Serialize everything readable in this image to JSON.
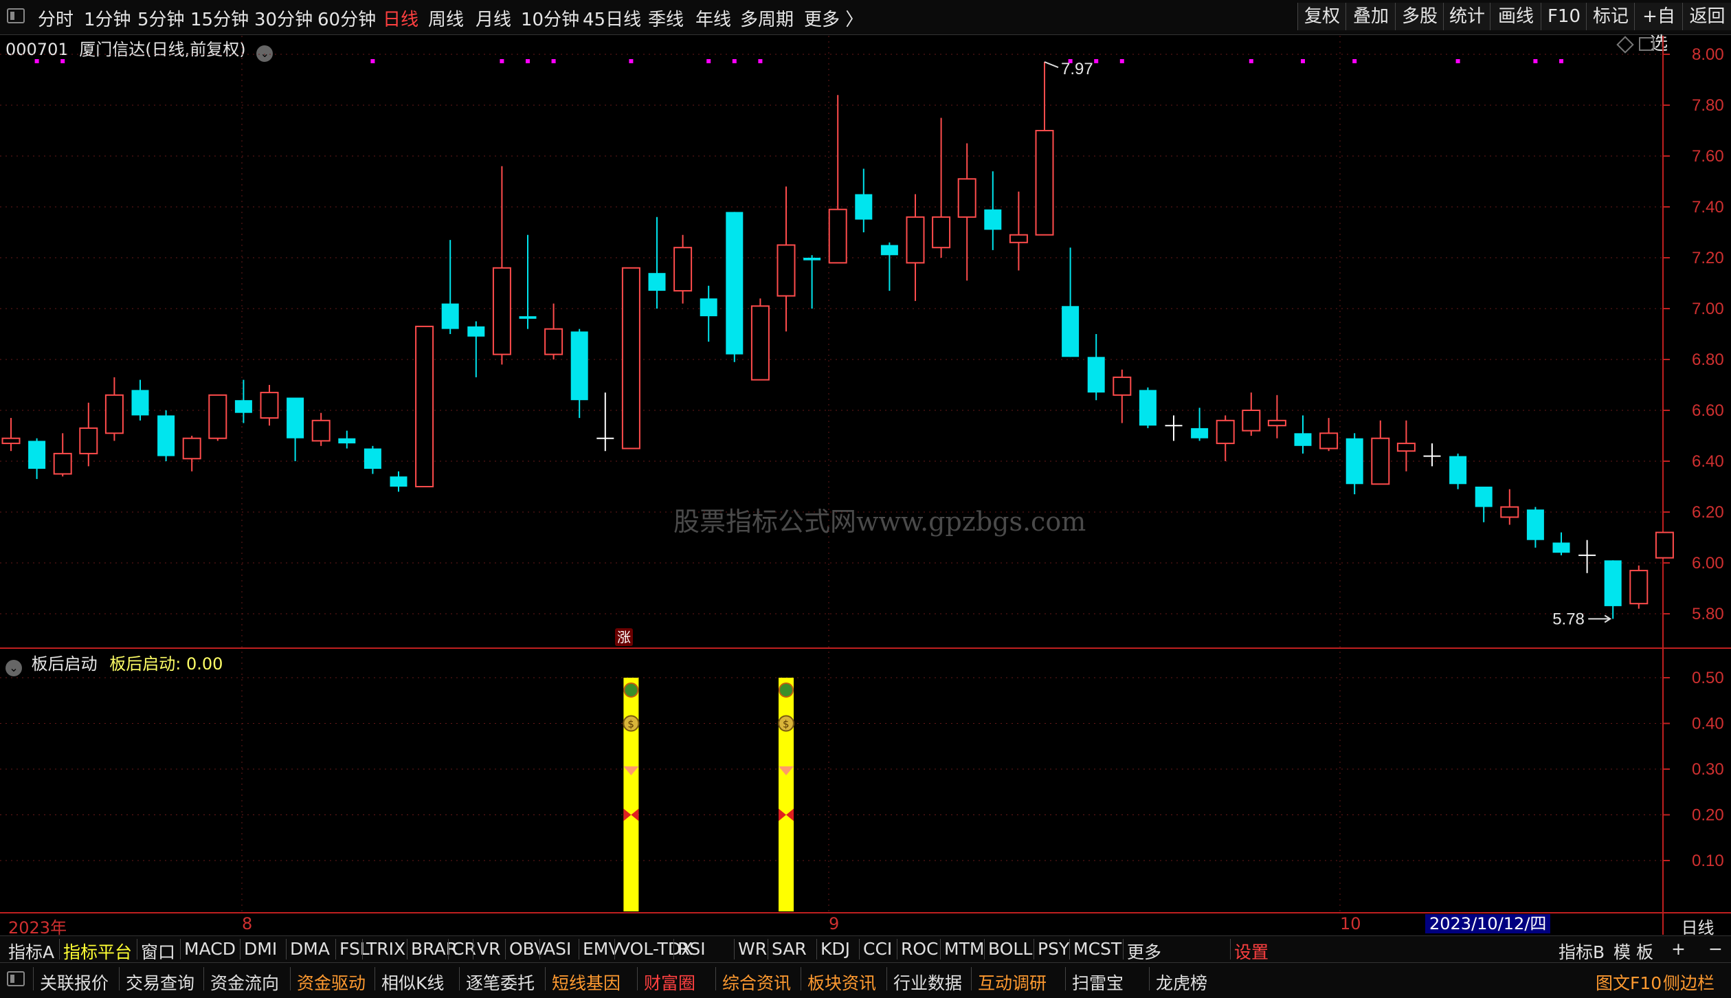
{
  "top_tabs": [
    "分时",
    "1分钟",
    "5分钟",
    "15分钟",
    "30分钟",
    "60分钟",
    "日线",
    "周线",
    "月线",
    "10分钟",
    "45日线",
    "季线",
    "年线",
    "多周期",
    "更多 〉"
  ],
  "top_active": "日线",
  "top_buttons": [
    "复权",
    "叠加",
    "多股",
    "统计",
    "画线",
    "F10",
    "标记",
    "+自选",
    "返回"
  ],
  "stock": {
    "code": "000701",
    "name": "厦门信达",
    "mode": "(日线,前复权)"
  },
  "indicator": {
    "name": "板后启动",
    "value_label": "板后启动: 0.00"
  },
  "watermark": "股票指标公式网www.gpzbgs.com",
  "marker_zhang": "涨",
  "date_labels": [
    "2023年",
    "8",
    "9",
    "10"
  ],
  "cursor_date": "2023/10/12/四",
  "period_label": "日线",
  "bottom_indicators": [
    "指标A",
    "指标平台",
    "窗口",
    "MACD",
    "DMI",
    "DMA",
    "FSL",
    "TRIX",
    "BRAR",
    "CR",
    "VR",
    "OBV",
    "ASI",
    "EMV",
    "VOL-TDX",
    "RSI",
    "WR",
    "SAR",
    "KDJ",
    "CCI",
    "ROC",
    "MTM",
    "BOLL",
    "PSY",
    "MCST",
    "更多",
    "设置"
  ],
  "bottom_right": [
    "指标B",
    "模 板",
    "+",
    "−"
  ],
  "bottom_tools": [
    "关联报价",
    "交易查询",
    "资金流向",
    "资金驱动",
    "相似K线",
    "逐笔委托",
    "短线基因",
    "财富圈",
    "综合资讯",
    "板块资讯",
    "行业数据",
    "互动调研",
    "扫雷宝",
    "龙虎榜"
  ],
  "bottom_tools_right": [
    "图文F10",
    "侧边栏"
  ],
  "colors": {
    "up": "#ff4c4c",
    "down": "#00e5ee",
    "axis": "#c02020",
    "grid": "#6a1a1a",
    "highlight": "#ffff00",
    "magenta": "#ff00ff"
  },
  "chart_data": [
    {
      "type": "candlestick",
      "ylim": [
        5.7,
        8.05
      ],
      "y_ticks": [
        "8.00",
        "7.80",
        "7.60",
        "7.40",
        "7.20",
        "7.00",
        "6.80",
        "6.60",
        "6.40",
        "6.20",
        "6.00",
        "5.80"
      ],
      "annotations": [
        {
          "text": "7.97",
          "value": 7.97
        },
        {
          "text": "5.78",
          "value": 5.78
        }
      ],
      "candles": [
        {
          "o": 6.47,
          "c": 6.49,
          "h": 6.57,
          "l": 6.44
        },
        {
          "o": 6.48,
          "c": 6.37,
          "h": 6.49,
          "l": 6.33
        },
        {
          "o": 6.35,
          "c": 6.43,
          "h": 6.51,
          "l": 6.34
        },
        {
          "o": 6.43,
          "c": 6.53,
          "h": 6.63,
          "l": 6.38
        },
        {
          "o": 6.51,
          "c": 6.66,
          "h": 6.73,
          "l": 6.48
        },
        {
          "o": 6.68,
          "c": 6.58,
          "h": 6.72,
          "l": 6.56
        },
        {
          "o": 6.58,
          "c": 6.42,
          "h": 6.6,
          "l": 6.4
        },
        {
          "o": 6.41,
          "c": 6.49,
          "h": 6.5,
          "l": 6.36
        },
        {
          "o": 6.49,
          "c": 6.66,
          "h": 6.66,
          "l": 6.48
        },
        {
          "o": 6.64,
          "c": 6.59,
          "h": 6.72,
          "l": 6.55
        },
        {
          "o": 6.57,
          "c": 6.67,
          "h": 6.7,
          "l": 6.54
        },
        {
          "o": 6.65,
          "c": 6.49,
          "h": 6.65,
          "l": 6.4
        },
        {
          "o": 6.48,
          "c": 6.56,
          "h": 6.59,
          "l": 6.46
        },
        {
          "o": 6.49,
          "c": 6.47,
          "h": 6.52,
          "l": 6.45
        },
        {
          "o": 6.45,
          "c": 6.37,
          "h": 6.46,
          "l": 6.35
        },
        {
          "o": 6.34,
          "c": 6.3,
          "h": 6.36,
          "l": 6.28
        },
        {
          "o": 6.3,
          "c": 6.93,
          "h": 6.93,
          "l": 6.3
        },
        {
          "o": 7.02,
          "c": 6.92,
          "h": 7.27,
          "l": 6.9
        },
        {
          "o": 6.93,
          "c": 6.89,
          "h": 6.95,
          "l": 6.73
        },
        {
          "o": 6.82,
          "c": 7.16,
          "h": 7.56,
          "l": 6.78
        },
        {
          "o": 6.97,
          "c": 6.96,
          "h": 7.29,
          "l": 6.92
        },
        {
          "o": 6.82,
          "c": 6.92,
          "h": 7.02,
          "l": 6.8
        },
        {
          "o": 6.91,
          "c": 6.64,
          "h": 6.92,
          "l": 6.57
        },
        {
          "o": 6.49,
          "c": 6.49,
          "h": 6.67,
          "l": 6.44
        },
        {
          "o": 6.45,
          "c": 7.16,
          "h": 7.16,
          "l": 6.45
        },
        {
          "o": 7.14,
          "c": 7.07,
          "h": 7.36,
          "l": 7.0
        },
        {
          "o": 7.07,
          "c": 7.24,
          "h": 7.29,
          "l": 7.02
        },
        {
          "o": 7.04,
          "c": 6.97,
          "h": 7.09,
          "l": 6.87
        },
        {
          "o": 7.38,
          "c": 6.82,
          "h": 7.38,
          "l": 6.79
        },
        {
          "o": 6.72,
          "c": 7.01,
          "h": 7.04,
          "l": 6.72
        },
        {
          "o": 7.05,
          "c": 7.25,
          "h": 7.48,
          "l": 6.91
        },
        {
          "o": 7.2,
          "c": 7.19,
          "h": 7.21,
          "l": 7.0
        },
        {
          "o": 7.18,
          "c": 7.39,
          "h": 7.84,
          "l": 7.18
        },
        {
          "o": 7.45,
          "c": 7.35,
          "h": 7.55,
          "l": 7.3
        },
        {
          "o": 7.25,
          "c": 7.21,
          "h": 7.26,
          "l": 7.07
        },
        {
          "o": 7.18,
          "c": 7.36,
          "h": 7.45,
          "l": 7.03
        },
        {
          "o": 7.24,
          "c": 7.36,
          "h": 7.75,
          "l": 7.2
        },
        {
          "o": 7.36,
          "c": 7.51,
          "h": 7.65,
          "l": 7.11
        },
        {
          "o": 7.39,
          "c": 7.31,
          "h": 7.54,
          "l": 7.23
        },
        {
          "o": 7.26,
          "c": 7.29,
          "h": 7.46,
          "l": 7.15
        },
        {
          "o": 7.29,
          "c": 7.7,
          "h": 7.97,
          "l": 7.29
        },
        {
          "o": 7.01,
          "c": 6.81,
          "h": 7.24,
          "l": 6.81
        },
        {
          "o": 6.81,
          "c": 6.67,
          "h": 6.9,
          "l": 6.64
        },
        {
          "o": 6.66,
          "c": 6.73,
          "h": 6.76,
          "l": 6.55
        },
        {
          "o": 6.68,
          "c": 6.54,
          "h": 6.69,
          "l": 6.53
        },
        {
          "o": 6.54,
          "c": 6.54,
          "h": 6.58,
          "l": 6.48
        },
        {
          "o": 6.53,
          "c": 6.49,
          "h": 6.61,
          "l": 6.48
        },
        {
          "o": 6.47,
          "c": 6.56,
          "h": 6.58,
          "l": 6.4
        },
        {
          "o": 6.52,
          "c": 6.6,
          "h": 6.67,
          "l": 6.5
        },
        {
          "o": 6.54,
          "c": 6.56,
          "h": 6.66,
          "l": 6.49
        },
        {
          "o": 6.51,
          "c": 6.46,
          "h": 6.58,
          "l": 6.43
        },
        {
          "o": 6.45,
          "c": 6.51,
          "h": 6.57,
          "l": 6.44
        },
        {
          "o": 6.49,
          "c": 6.31,
          "h": 6.51,
          "l": 6.27
        },
        {
          "o": 6.31,
          "c": 6.49,
          "h": 6.56,
          "l": 6.31
        },
        {
          "o": 6.44,
          "c": 6.47,
          "h": 6.56,
          "l": 6.36
        },
        {
          "o": 6.42,
          "c": 6.42,
          "h": 6.47,
          "l": 6.38
        },
        {
          "o": 6.42,
          "c": 6.31,
          "h": 6.43,
          "l": 6.29
        },
        {
          "o": 6.3,
          "c": 6.22,
          "h": 6.3,
          "l": 6.16
        },
        {
          "o": 6.18,
          "c": 6.22,
          "h": 6.29,
          "l": 6.15
        },
        {
          "o": 6.21,
          "c": 6.09,
          "h": 6.22,
          "l": 6.06
        },
        {
          "o": 6.08,
          "c": 6.04,
          "h": 6.12,
          "l": 6.03
        },
        {
          "o": 6.03,
          "c": 6.03,
          "h": 6.09,
          "l": 5.96
        },
        {
          "o": 6.01,
          "c": 5.83,
          "h": 6.01,
          "l": 5.78
        },
        {
          "o": 5.84,
          "c": 5.97,
          "h": 5.99,
          "l": 5.82
        },
        {
          "o": 6.02,
          "c": 6.12,
          "h": 6.12,
          "l": 6.02
        }
      ],
      "top_dots_index": [
        1,
        2,
        14,
        19,
        20,
        21,
        24,
        27,
        28,
        29,
        41,
        42,
        43,
        48,
        50,
        52,
        56,
        59,
        60
      ]
    },
    {
      "type": "bar",
      "title": "板后启动",
      "ylim": [
        0,
        0.57
      ],
      "y_ticks": [
        "0.50",
        "0.40",
        "0.30",
        "0.20",
        "0.10"
      ],
      "signals": [
        {
          "index": 24,
          "value": 0.5
        },
        {
          "index": 30,
          "value": 0.5
        }
      ]
    }
  ]
}
